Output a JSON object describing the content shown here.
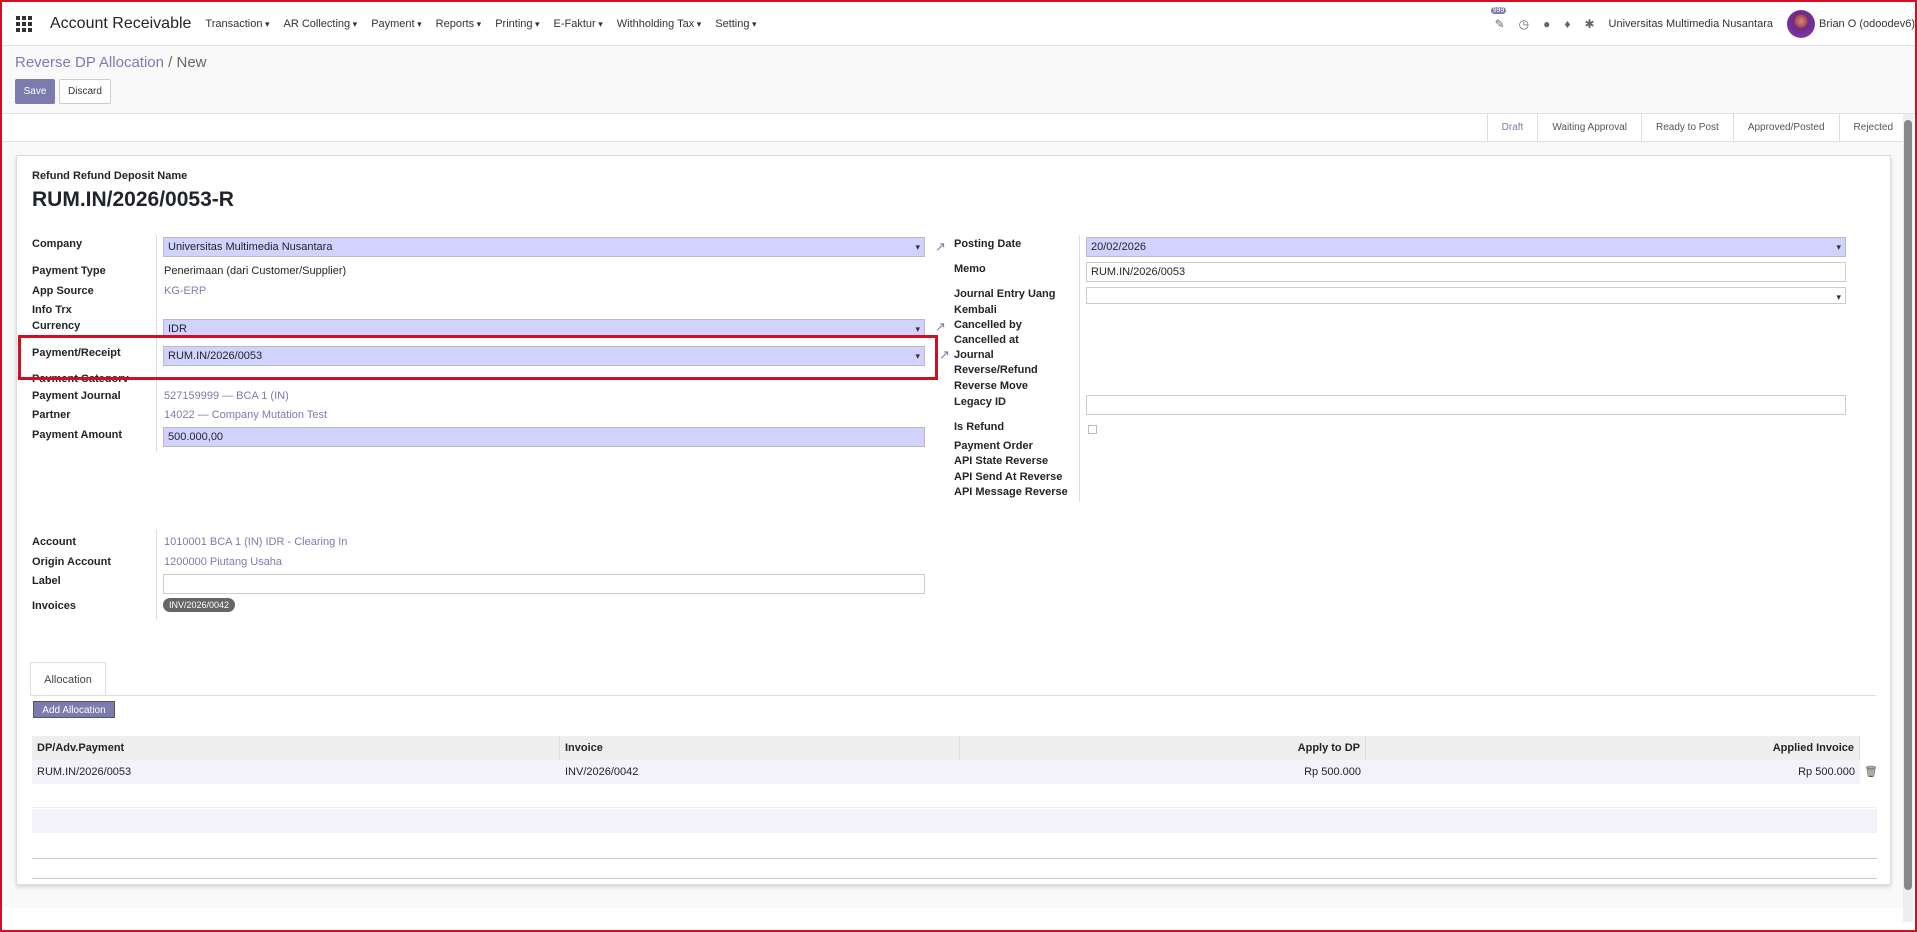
{
  "navbar": {
    "app_title": "Account Receivable",
    "menus": [
      "Transaction",
      "AR Collecting",
      "Payment",
      "Reports",
      "Printing",
      "E-Faktur",
      "Withholding Tax",
      "Setting"
    ],
    "badge": "999",
    "company": "Universitas Multimedia Nusantara",
    "user": "Brian O (odoodev6)"
  },
  "breadcrumb": {
    "parent": "Reverse DP Allocation",
    "current": "New"
  },
  "buttons": {
    "save": "Save",
    "discard": "Discard",
    "add_allocation": "Add Allocation"
  },
  "stages": [
    "Draft",
    "Waiting Approval",
    "Ready to Post",
    "Approved/Posted",
    "Rejected"
  ],
  "form": {
    "name_label": "Refund Refund Deposit Name",
    "name": "RUM.IN/2026/0053-R",
    "left_labels": {
      "company": "Company",
      "payment_type": "Payment Type",
      "app_source": "App Source",
      "info_trx": "Info Trx",
      "currency": "Currency",
      "payment_receipt": "Payment/Receipt",
      "payment_category": "Payment Category",
      "payment_journal": "Payment Journal",
      "partner": "Partner",
      "payment_amount": "Payment Amount"
    },
    "left_values": {
      "company": "Universitas Multimedia Nusantara",
      "payment_type": "Penerimaan (dari Customer/Supplier)",
      "app_source": "KG-ERP",
      "currency": "IDR",
      "payment_receipt": "RUM.IN/2026/0053",
      "payment_journal": "527159999 — BCA 1 (IN)",
      "partner": "14022 — Company Mutation Test",
      "payment_amount": "500.000,00"
    },
    "right_labels": {
      "posting_date": "Posting Date",
      "memo": "Memo",
      "journal_entry_1": "Journal Entry Uang",
      "journal_entry_2": "Kembali",
      "cancelled_by": "Cancelled by",
      "cancelled_at": "Cancelled at",
      "journal": "Journal",
      "reverse_refund": "Reverse/Refund",
      "reverse_move": "Reverse Move",
      "legacy_id": "Legacy ID",
      "is_refund": "Is Refund",
      "payment_order": "Payment Order",
      "api_state": "API State Reverse",
      "api_send": "API Send At Reverse",
      "api_message": "API Message Reverse"
    },
    "right_values": {
      "posting_date": "20/02/2026",
      "memo": "RUM.IN/2026/0053"
    },
    "bottom_labels": {
      "account": "Account",
      "origin_account": "Origin Account",
      "label": "Label",
      "invoices": "Invoices"
    },
    "bottom_values": {
      "account": "1010001 BCA 1 (IN) IDR - Clearing In",
      "origin_account": "1200000 Piutang Usaha",
      "invoice_tag": "INV/2026/0042"
    }
  },
  "tab": {
    "label": "Allocation"
  },
  "table": {
    "columns": [
      "DP/Adv.Payment",
      "Invoice",
      "Apply to DP",
      "Applied Invoice"
    ],
    "rows": [
      [
        "RUM.IN/2026/0053",
        "INV/2026/0042",
        "Rp 500.000",
        "Rp 500.000"
      ]
    ]
  }
}
